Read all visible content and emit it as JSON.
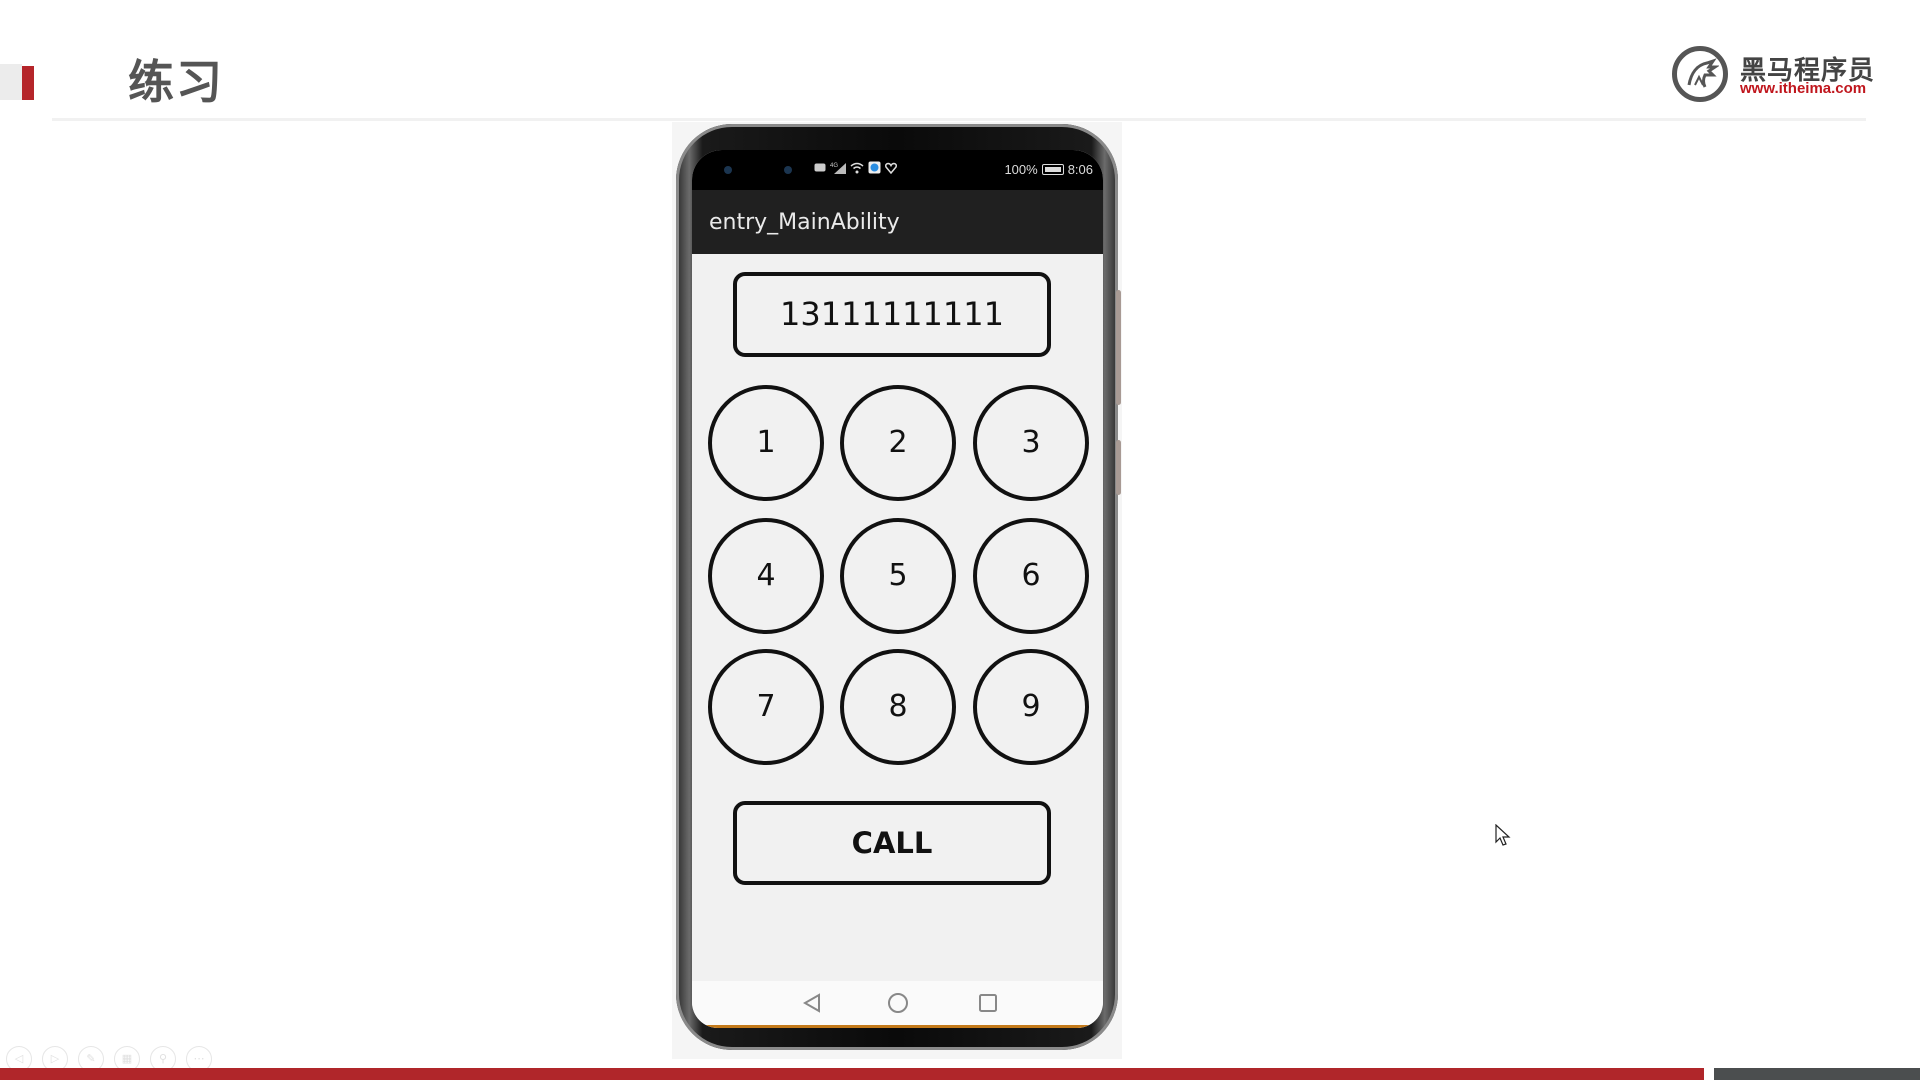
{
  "slide": {
    "title": "练习",
    "accent_color": "#b5252a"
  },
  "logo": {
    "name_cn": "黑马程序员",
    "url": "www.itheima.com",
    "url_color": "#c0161d"
  },
  "phone": {
    "status_bar": {
      "left_icons": [
        "sim-icon",
        "signal-icon",
        "wifi-icon",
        "app-notification-icon",
        "heart-icon"
      ],
      "battery_text": "100%",
      "time": "8:06"
    },
    "app_bar": {
      "title": "entry_MainAbility"
    },
    "dialer": {
      "number_value": "13111111111",
      "keys": [
        "1",
        "2",
        "3",
        "4",
        "5",
        "6",
        "7",
        "8",
        "9"
      ],
      "call_label": "CALL"
    },
    "nav_bar": {
      "buttons": [
        "back-icon",
        "home-icon",
        "recents-icon"
      ]
    }
  },
  "presentation_controls": {
    "buttons": [
      "previous",
      "next",
      "pen",
      "slides",
      "zoom",
      "more"
    ],
    "glyphs": [
      "◁",
      "▷",
      "✎",
      "▦",
      "⚲",
      "⋯"
    ]
  },
  "footer": {
    "bar_color": "#b0262a",
    "bar_secondary_color": "#4b4e4f"
  }
}
